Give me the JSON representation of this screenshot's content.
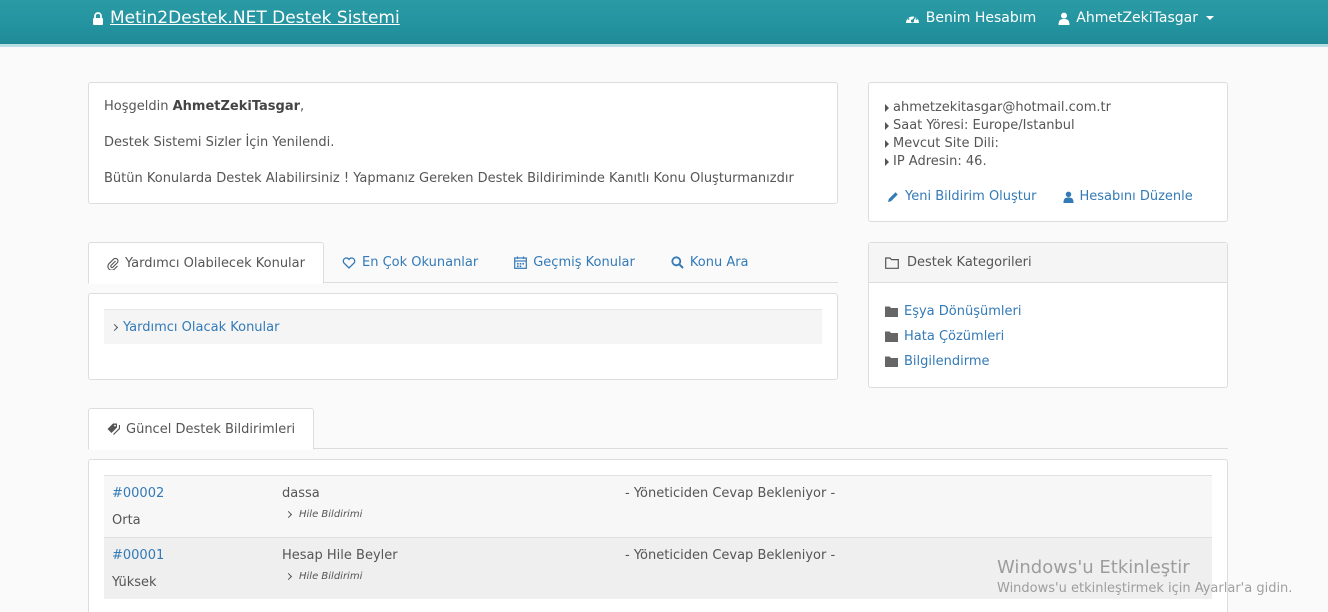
{
  "navbar": {
    "brand": "Metin2Destek.NET Destek Sistemi",
    "account_label": "Benim Hesabım",
    "user_label": "AhmetZekiTasgar"
  },
  "welcome": {
    "greeting_prefix": "Hoşgeldin ",
    "username": "AhmetZekiTasgar",
    "greeting_suffix": ",",
    "line2": "Destek Sistemi Sizler İçin Yenilendi.",
    "line3": "Bütün Konularda Destek Alabilirsiniz ! Yapmanız Gereken Destek Bildiriminde Kanıtlı Konu Oluşturmanızdır"
  },
  "user_info": {
    "email": "ahmetzekitasgar@hotmail.com.tr",
    "timezone": "Saat Yöresi: Europe/Istanbul",
    "site_language": "Mevcut Site Dili: ",
    "ip": "IP Adresin: 46.",
    "new_ticket": "Yeni Bildirim Oluştur",
    "edit_account": "Hesabını Düzenle"
  },
  "tabs": [
    {
      "label": "Yardımcı Olabilecek Konular",
      "icon": "paperclip-icon",
      "active": true
    },
    {
      "label": "En Çok Okunanlar",
      "icon": "heart-icon",
      "active": false
    },
    {
      "label": "Geçmiş Konular",
      "icon": "calendar-icon",
      "active": false
    },
    {
      "label": "Konu Ara",
      "icon": "search-icon",
      "active": false
    }
  ],
  "tab_content": {
    "accordion_label": "Yardımcı Olacak Konular"
  },
  "categories": {
    "title": "Destek Kategorileri",
    "items": [
      "Eşya Dönüşümleri",
      "Hata Çözümleri",
      "Bilgilendirme"
    ]
  },
  "tickets_tab": {
    "label": "Güncel Destek Bildirimleri"
  },
  "tickets": [
    {
      "id": "#00002",
      "priority": "Orta",
      "subject": "dassa",
      "category": "Hile Bildirimi",
      "status": "- Yöneticiden Cevap Bekleniyor -"
    },
    {
      "id": "#00001",
      "priority": "Yüksek",
      "subject": "Hesap Hile Beyler",
      "category": "Hile Bildirimi",
      "status": "- Yöneticiden Cevap Bekleniyor -"
    }
  ],
  "watermark": {
    "title": "Windows'u Etkinleştir",
    "subtitle": "Windows'u etkinleştirmek için Ayarlar'a gidin."
  },
  "colors": {
    "navbar": "#2393a0",
    "link": "#337ab7",
    "panel_border": "#dddddd"
  }
}
